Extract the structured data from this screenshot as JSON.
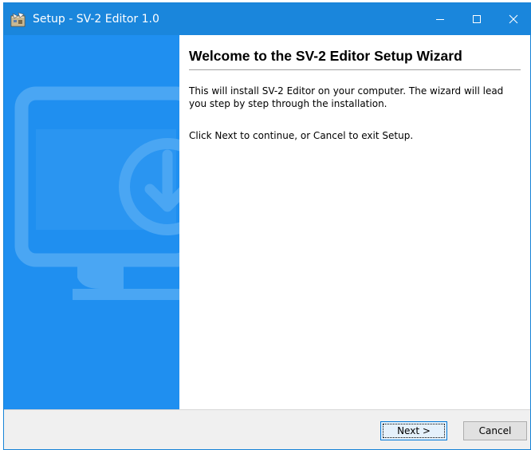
{
  "window": {
    "title": "Setup - SV-2 Editor 1.0",
    "app_icon": "setup-box-icon",
    "controls": {
      "minimize_icon": "minimize-icon",
      "maximize_icon": "maximize-icon",
      "close_icon": "close-icon"
    }
  },
  "sidebar": {
    "artwork_icon": "monitor-download-icon",
    "background_color": "#1f8ff0"
  },
  "content": {
    "heading": "Welcome to the SV-2 Editor Setup Wizard",
    "paragraphs": [
      "This will install SV-2 Editor on your computer. The wizard will lead you step by step through the installation.",
      "Click Next to continue, or Cancel to exit Setup."
    ]
  },
  "buttons": {
    "next": "Next >",
    "cancel": "Cancel"
  },
  "colors": {
    "titlebar": "#1a86dc",
    "accent_border": "#0078d7"
  }
}
